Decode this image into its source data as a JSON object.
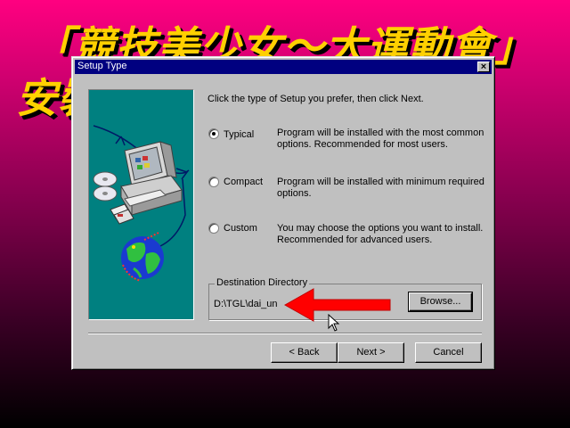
{
  "banner": {
    "line1": "「競技美少女～大運動會」",
    "line2": "安裝"
  },
  "dialog": {
    "title": "Setup Type",
    "close_glyph": "×",
    "instruction": "Click the type of Setup you prefer, then click Next.",
    "options": [
      {
        "label": "Typical",
        "description": "Program will be installed with the most common options. Recommended for most users.",
        "selected": true
      },
      {
        "label": "Compact",
        "description": "Program will be installed with minimum required options.",
        "selected": false
      },
      {
        "label": "Custom",
        "description": "You may choose the options you want to install. Recommended for advanced users.",
        "selected": false
      }
    ],
    "destination": {
      "group_label": "Destination Directory",
      "path": "D:\\TGL\\dai_un",
      "browse_label": "Browse..."
    },
    "buttons": {
      "back": "< Back",
      "next": "Next >",
      "cancel": "Cancel"
    }
  },
  "annotation": {
    "arrow_color": "#ff0000"
  },
  "icons": [
    "computer-illustration",
    "cd-discs-icon",
    "floppy-disks-icon",
    "globe-icon",
    "mouse-cursor-icon",
    "red-arrow-icon"
  ]
}
